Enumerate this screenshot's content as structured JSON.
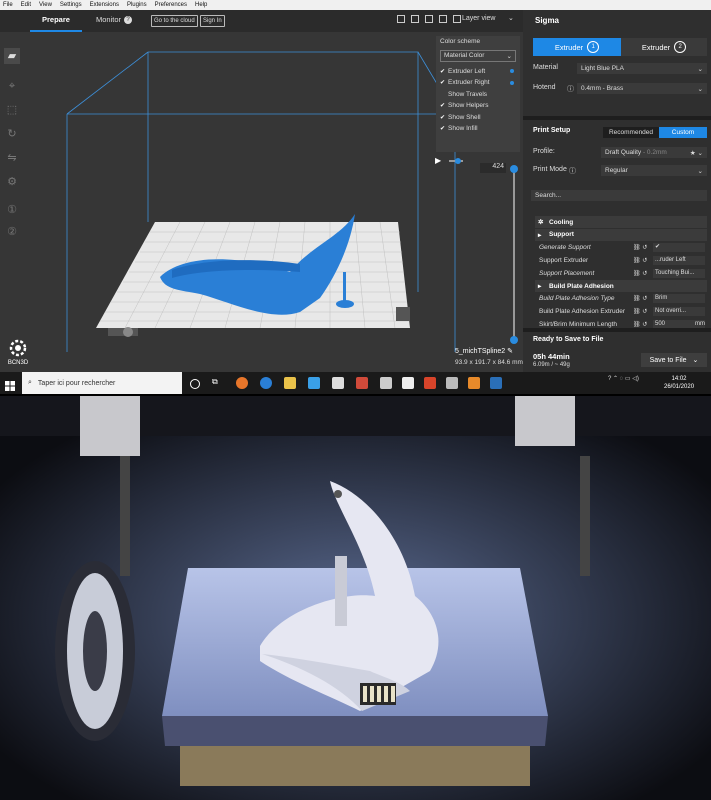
{
  "menubar": [
    "File",
    "Edit",
    "View",
    "Settings",
    "Extensions",
    "Plugins",
    "Preferences",
    "Help"
  ],
  "header": {
    "tab_prepare": "Prepare",
    "tab_monitor": "Monitor",
    "go_cloud": "Go to the cloud",
    "sign_in": "Sign In",
    "view_mode": "Layer view"
  },
  "colorpanel": {
    "title": "Color scheme",
    "scheme": "Material Color",
    "items": [
      "Extruder Left",
      "Extruder Right",
      "Show Travels",
      "Show Helpers",
      "Show Shell",
      "Show Infill"
    ]
  },
  "viewport": {
    "layer_number": "424",
    "logo": "BCN3D",
    "filename": "5_michTSpline2",
    "dims": "93.9 x 191.7 x 84.6 mm"
  },
  "sidebar": {
    "printer": "Sigma",
    "extruder1": "Extruder",
    "extruder1_num": "1",
    "extruder2": "Extruder",
    "extruder2_num": "2",
    "material_label": "Material",
    "material": "Light Blue PLA",
    "hotend_label": "Hotend",
    "hotend": "0.4mm - Brass",
    "setup_title": "Print Setup",
    "recommended": "Recommended",
    "custom": "Custom",
    "profile_label": "Profile:",
    "profile": "Draft Quality",
    "profile_suffix": "- 0.2mm",
    "mode_label": "Print Mode",
    "mode": "Regular",
    "search": "Search...",
    "settings": [
      {
        "label": "Cooling",
        "cat": true
      },
      {
        "label": "Support",
        "cat": true
      },
      {
        "label": "Generate Support",
        "italic": true,
        "value": "✔"
      },
      {
        "label": "Support Extruder",
        "value": "...ruder Left"
      },
      {
        "label": "Support Placement",
        "italic": true,
        "value": "Touching Bui..."
      },
      {
        "label": "Build Plate Adhesion",
        "cat": true
      },
      {
        "label": "Build Plate Adhesion Type",
        "italic": true,
        "value": "Brim"
      },
      {
        "label": "Build Plate Adhesion Extruder",
        "value": "Not overri..."
      },
      {
        "label": "Skirt/Brim Minimum Length",
        "value": "500",
        "unit": "mm"
      }
    ],
    "ready": "Ready to Save to File",
    "time": "05h 44min",
    "weight": "6.09m / ~ 49g",
    "save": "Save to File"
  },
  "taskbar": {
    "search": "Taper ici pour rechercher",
    "time": "14:02",
    "date": "26/01/2020"
  },
  "colors": {
    "accent": "#1e88e5",
    "model": "#2a7fd6",
    "plate": "#e8e8e8"
  }
}
